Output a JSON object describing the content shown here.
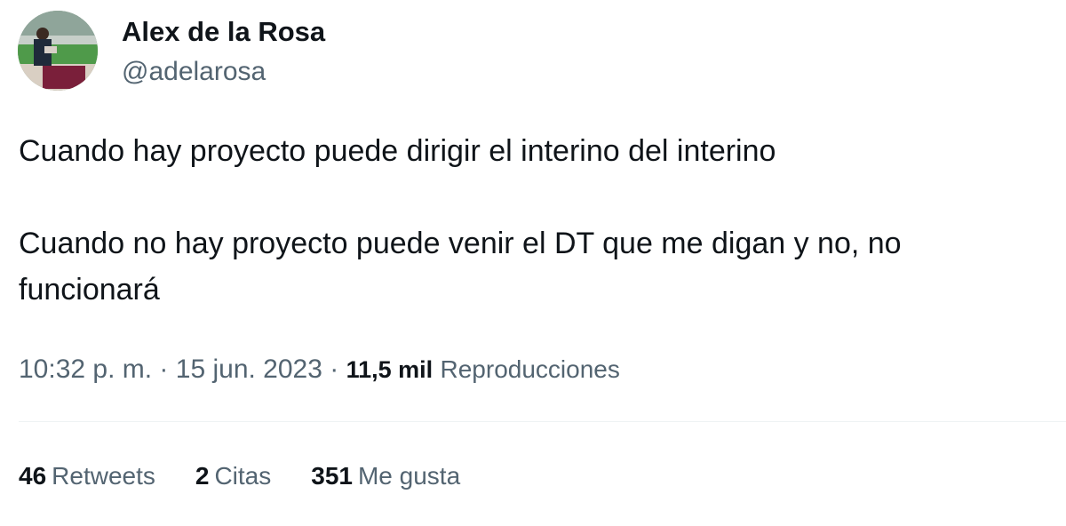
{
  "author": {
    "display_name": "Alex de la Rosa",
    "handle": "@adelarosa"
  },
  "tweet": {
    "paragraph_1": "Cuando hay proyecto puede dirigir el interino del interino",
    "paragraph_2": "Cuando no hay proyecto puede venir el DT que me digan y no, no funcionará"
  },
  "meta": {
    "time": "10:32 p. m.",
    "separator": " · ",
    "date": "15 jun. 2023",
    "views_count": "11,5 mil",
    "views_label": "Reproducciones"
  },
  "stats": {
    "retweets_count": "46",
    "retweets_label": "Retweets",
    "quotes_count": "2",
    "quotes_label": "Citas",
    "likes_count": "351",
    "likes_label": "Me gusta"
  },
  "colors": {
    "text_primary": "#0f1419",
    "text_secondary": "#536471",
    "divider": "#eff3f4"
  }
}
